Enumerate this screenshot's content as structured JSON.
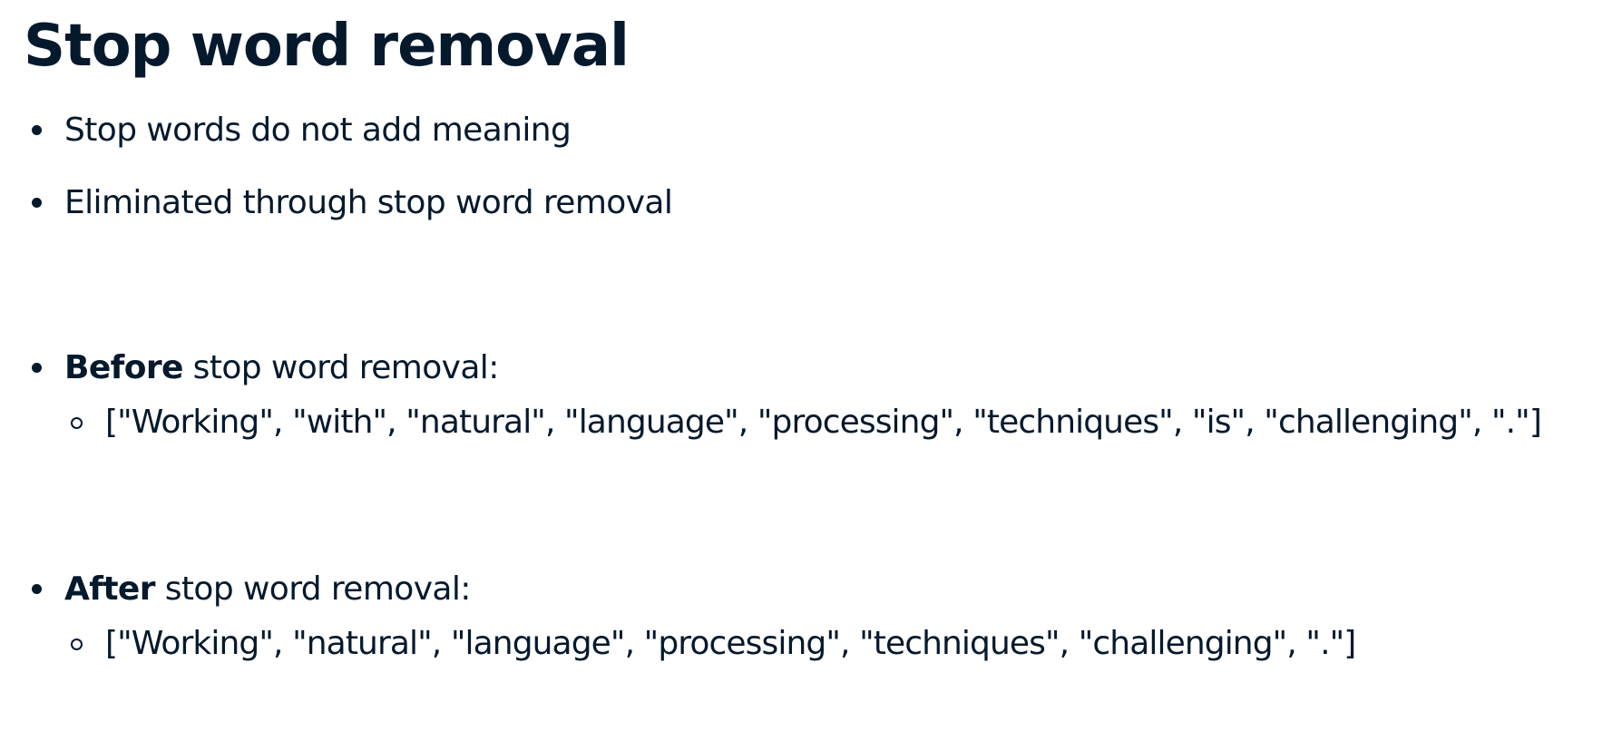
{
  "title": "Stop word removal",
  "bullets": [
    {
      "text": "Stop words do not add meaning"
    },
    {
      "text": "Eliminated through stop word removal"
    }
  ],
  "before": {
    "bold": "Before",
    "rest": " stop word removal:",
    "tokens": "[\"Working\", \"with\", \"natural\", \"language\", \"processing\", \"techniques\", \"is\", \"challenging\", \".\"]"
  },
  "after": {
    "bold": "After",
    "rest": " stop word removal:",
    "tokens": "[\"Working\", \"natural\", \"language\", \"processing\", \"techniques\", \"challenging\", \".\"]"
  }
}
